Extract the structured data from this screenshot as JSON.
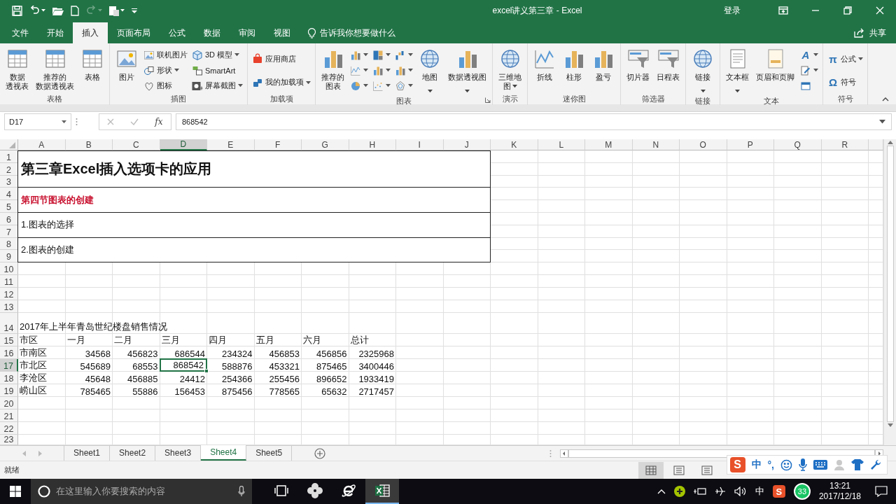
{
  "title_bar": {
    "title": "excel讲义第三章  -  Excel",
    "sign_in": "登录"
  },
  "menu": {
    "tabs": [
      {
        "label": "文件",
        "selected": false
      },
      {
        "label": "开始",
        "selected": false
      },
      {
        "label": "插入",
        "selected": true
      },
      {
        "label": "页面布局",
        "selected": false
      },
      {
        "label": "公式",
        "selected": false
      },
      {
        "label": "数据",
        "selected": false
      },
      {
        "label": "审阅",
        "selected": false
      },
      {
        "label": "视图",
        "selected": false
      }
    ],
    "tell_me": "告诉我你想要做什么",
    "share": "共享"
  },
  "ribbon": {
    "groups": [
      {
        "label": "表格",
        "items": [
          {
            "kind": "large",
            "lines": [
              "数据",
              "透视表"
            ],
            "dropdown": false
          },
          {
            "kind": "large",
            "lines": [
              "推荐的",
              "数据透视表"
            ],
            "dropdown": false
          },
          {
            "kind": "large",
            "lines": [
              "表格"
            ],
            "dropdown": false
          }
        ]
      },
      {
        "label": "插图",
        "items": [
          {
            "kind": "large",
            "lines": [
              "图片"
            ],
            "dropdown": false
          },
          {
            "kind": "stack",
            "items": [
              {
                "label": "联机图片",
                "dropdown": false
              },
              {
                "label": "形状",
                "dropdown": true
              },
              {
                "label": "图标",
                "dropdown": false
              }
            ]
          },
          {
            "kind": "stack",
            "items": [
              {
                "label": "3D 模型",
                "dropdown": true
              },
              {
                "label": "SmartArt",
                "dropdown": false
              },
              {
                "label": "屏幕截图",
                "dropdown": true
              }
            ]
          }
        ]
      },
      {
        "label": "加载项",
        "items": [
          {
            "kind": "stack",
            "items": [
              {
                "label": "应用商店",
                "dropdown": false
              },
              {
                "label": "我的加载项",
                "dropdown": true
              }
            ]
          }
        ]
      },
      {
        "label": "图表",
        "launcher": true,
        "items": [
          {
            "kind": "large",
            "lines": [
              "推荐的",
              "图表"
            ],
            "dropdown": false
          },
          {
            "kind": "stack",
            "items": [
              {
                "dropdown": true
              },
              {
                "dropdown": true
              },
              {
                "dropdown": true
              }
            ]
          },
          {
            "kind": "stack",
            "items": [
              {
                "dropdown": true
              },
              {
                "dropdown": true
              },
              {
                "dropdown": true
              }
            ]
          },
          {
            "kind": "stack",
            "items": [
              {
                "dropdown": true
              },
              {
                "dropdown": true
              },
              {
                "dropdown": true
              }
            ]
          },
          {
            "kind": "large",
            "lines": [
              "地图"
            ],
            "dropdown": true
          },
          {
            "kind": "large",
            "lines": [
              "数据透视图"
            ],
            "dropdown": true
          }
        ]
      },
      {
        "label": "演示",
        "items": [
          {
            "kind": "large",
            "lines": [
              "三维地",
              "图"
            ],
            "dropdown": true
          }
        ]
      },
      {
        "label": "迷你图",
        "items": [
          {
            "kind": "large",
            "lines": [
              "折线"
            ],
            "dropdown": false
          },
          {
            "kind": "large",
            "lines": [
              "柱形"
            ],
            "dropdown": false
          },
          {
            "kind": "large",
            "lines": [
              "盈亏"
            ],
            "dropdown": false
          }
        ]
      },
      {
        "label": "筛选器",
        "items": [
          {
            "kind": "large",
            "lines": [
              "切片器"
            ],
            "dropdown": false
          },
          {
            "kind": "large",
            "lines": [
              "日程表"
            ],
            "dropdown": false
          }
        ]
      },
      {
        "label": "链接",
        "items": [
          {
            "kind": "large",
            "lines": [
              "链接"
            ],
            "dropdown": true
          }
        ]
      },
      {
        "label": "文本",
        "items": [
          {
            "kind": "large",
            "lines": [
              "文本框"
            ],
            "dropdown": true
          },
          {
            "kind": "large",
            "lines": [
              "页眉和页脚"
            ],
            "dropdown": false
          },
          {
            "kind": "stack",
            "items": [
              {
                "glyph": "A",
                "dropdown": true
              },
              {
                "dropdown": true
              },
              {
                "dropdown": false
              }
            ]
          }
        ]
      },
      {
        "label": "符号",
        "items": [
          {
            "kind": "stack",
            "items": [
              {
                "glyph": "π",
                "label": "公式",
                "dropdown": true
              },
              {
                "glyph": "Ω",
                "label": "符号",
                "dropdown": false
              }
            ]
          }
        ]
      }
    ]
  },
  "formula_bar": {
    "name_box": "D17",
    "function_label": "fx",
    "value": "868542"
  },
  "sheet": {
    "columns": [
      {
        "label": "A",
        "selected": false
      },
      {
        "label": "B",
        "selected": false
      },
      {
        "label": "C",
        "selected": false
      },
      {
        "label": "D",
        "selected": true
      },
      {
        "label": "E",
        "selected": false
      },
      {
        "label": "F",
        "selected": false
      },
      {
        "label": "G",
        "selected": false
      },
      {
        "label": "H",
        "selected": false
      },
      {
        "label": "I",
        "selected": false
      },
      {
        "label": "J",
        "selected": false
      },
      {
        "label": "K",
        "selected": false
      },
      {
        "label": "L",
        "selected": false
      },
      {
        "label": "M",
        "selected": false
      },
      {
        "label": "N",
        "selected": false
      },
      {
        "label": "O",
        "selected": false
      },
      {
        "label": "P",
        "selected": false
      },
      {
        "label": "Q",
        "selected": false
      },
      {
        "label": "R",
        "selected": false
      }
    ],
    "rows": [
      {
        "label": "1",
        "selected": false
      },
      {
        "label": "2",
        "selected": false
      },
      {
        "label": "3",
        "selected": false
      },
      {
        "label": "4",
        "selected": false
      },
      {
        "label": "5",
        "selected": false
      },
      {
        "label": "6",
        "selected": false
      },
      {
        "label": "7",
        "selected": false
      },
      {
        "label": "8",
        "selected": false
      },
      {
        "label": "9",
        "selected": false
      },
      {
        "label": "10",
        "selected": false
      },
      {
        "label": "11",
        "selected": false
      },
      {
        "label": "12",
        "selected": false
      },
      {
        "label": "13",
        "selected": false
      },
      {
        "label": "14",
        "selected": false
      },
      {
        "label": "15",
        "selected": false
      },
      {
        "label": "16",
        "selected": false
      },
      {
        "label": "17",
        "selected": true
      },
      {
        "label": "18",
        "selected": false
      },
      {
        "label": "19",
        "selected": false
      },
      {
        "label": "20",
        "selected": false
      },
      {
        "label": "21",
        "selected": false
      },
      {
        "label": "22",
        "selected": false
      },
      {
        "label": "23",
        "selected": false
      }
    ],
    "blocks": [
      {
        "kind": "title",
        "text": "第三章Excel插入选项卡的应用"
      },
      {
        "kind": "heading",
        "text": "第四节图表的创建"
      },
      {
        "kind": "body",
        "text": "1.图表的选择"
      },
      {
        "kind": "body",
        "text": "2.图表的创建"
      }
    ],
    "table": {
      "caption": "2017年上半年青岛世纪楼盘销售情况",
      "header": [
        "市区",
        "一月",
        "二月",
        "三月",
        "四月",
        "五月",
        "六月",
        "总计"
      ],
      "rows": [
        {
          "cells": [
            {
              "text": "市南区",
              "selected": false
            },
            {
              "text": "34568",
              "selected": false
            },
            {
              "text": "456823",
              "selected": false
            },
            {
              "text": "686544",
              "selected": false
            },
            {
              "text": "234324",
              "selected": false
            },
            {
              "text": "456853",
              "selected": false
            },
            {
              "text": "456856",
              "selected": false
            },
            {
              "text": "2325968",
              "selected": false
            }
          ]
        },
        {
          "cells": [
            {
              "text": "市北区",
              "selected": false
            },
            {
              "text": "545689",
              "selected": false
            },
            {
              "text": "68553",
              "selected": false
            },
            {
              "text": "868542",
              "selected": true
            },
            {
              "text": "588876",
              "selected": false
            },
            {
              "text": "453321",
              "selected": false
            },
            {
              "text": "875465",
              "selected": false
            },
            {
              "text": "3400446",
              "selected": false
            }
          ]
        },
        {
          "cells": [
            {
              "text": "李沧区",
              "selected": false
            },
            {
              "text": "45648",
              "selected": false
            },
            {
              "text": "456885",
              "selected": false
            },
            {
              "text": "24412",
              "selected": false
            },
            {
              "text": "254366",
              "selected": false
            },
            {
              "text": "255456",
              "selected": false
            },
            {
              "text": "896652",
              "selected": false
            },
            {
              "text": "1933419",
              "selected": false
            }
          ]
        },
        {
          "cells": [
            {
              "text": "崂山区",
              "selected": false
            },
            {
              "text": "785465",
              "selected": false
            },
            {
              "text": "55886",
              "selected": false
            },
            {
              "text": "156453",
              "selected": false
            },
            {
              "text": "875456",
              "selected": false
            },
            {
              "text": "778565",
              "selected": false
            },
            {
              "text": "65632",
              "selected": false
            },
            {
              "text": "2717457",
              "selected": false
            }
          ]
        }
      ]
    }
  },
  "sheet_tabs": [
    {
      "label": "Sheet1",
      "selected": false
    },
    {
      "label": "Sheet2",
      "selected": false
    },
    {
      "label": "Sheet3",
      "selected": false
    },
    {
      "label": "Sheet4",
      "selected": true
    },
    {
      "label": "Sheet5",
      "selected": false
    }
  ],
  "status_bar": {
    "status": "就绪",
    "views": [
      {
        "selected": true
      },
      {
        "selected": false
      },
      {
        "selected": false
      }
    ]
  },
  "ime_toolbar": {
    "logo": "S",
    "mode": "中",
    "punctuation": "°,"
  },
  "taskbar": {
    "search_placeholder": "在这里输入你要搜索的内容",
    "apps": [
      {
        "kind": "task_view",
        "selected": false
      },
      {
        "kind": "pinwheel",
        "selected": false
      },
      {
        "kind": "browser",
        "selected": false
      },
      {
        "kind": "spreadsheet",
        "selected": true
      }
    ],
    "tray": {
      "input_mode": "中",
      "ime_logo": "S",
      "badge": "33",
      "time": "13:21",
      "date": "2017/12/18"
    }
  }
}
